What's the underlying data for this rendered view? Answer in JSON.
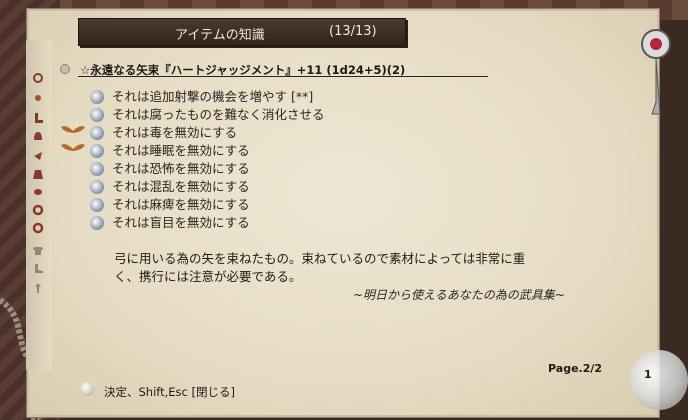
{
  "window": {
    "title": "アイテムの知識",
    "counter": "(13/13)"
  },
  "item": {
    "name": "☆永遠なる矢束『ハートジャッジメント』+11 (1d24+5)(2)"
  },
  "properties": [
    {
      "text": "それは追加射撃の機会を増やす [**]",
      "icon": "orb-icon",
      "marker": ""
    },
    {
      "text": "それは腐ったものを難なく消化させる",
      "icon": "orb-icon",
      "marker": ""
    },
    {
      "text": "それは毒を無効にする",
      "icon": "orb-icon",
      "marker": "wings-icon"
    },
    {
      "text": "それは睡眠を無効にする",
      "icon": "orb-icon",
      "marker": "wings-icon"
    },
    {
      "text": "それは恐怖を無効にする",
      "icon": "orb-icon",
      "marker": ""
    },
    {
      "text": "それは混乱を無効にする",
      "icon": "orb-icon",
      "marker": ""
    },
    {
      "text": "それは麻痺を無効にする",
      "icon": "orb-icon",
      "marker": ""
    },
    {
      "text": "それは盲目を無効にする",
      "icon": "orb-icon",
      "marker": ""
    }
  ],
  "description": {
    "line1": "弓に用いる為の矢を束ねたもの。束ねているので素材によっては非常に重",
    "line2": "く、携行には注意が必要である。",
    "source": "~明日から使えるあなたの為の武具集~"
  },
  "pagination": {
    "label": "Page.2/2",
    "extra": "1"
  },
  "footer": {
    "controls": "決定、Shift,Esc [閉じる]"
  },
  "colors": {
    "parchment": "#e6dcc4",
    "title_bar": "#3a2d23",
    "text": "#1e1a16"
  }
}
